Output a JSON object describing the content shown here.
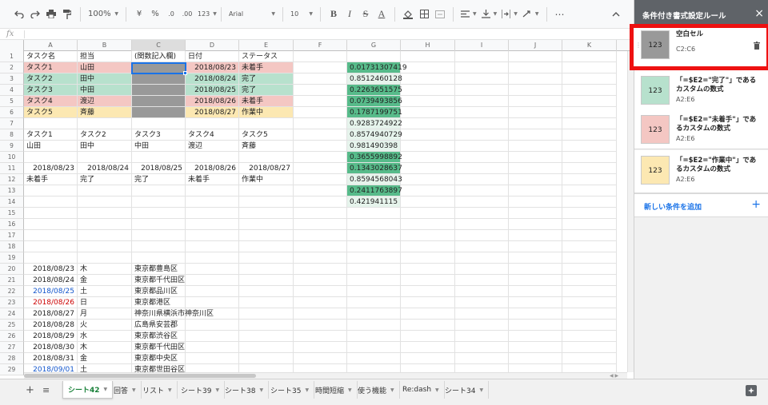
{
  "toolbar": {
    "undo_icon": "undo-icon",
    "redo_icon": "redo-icon",
    "print_icon": "print-icon",
    "paint_format_icon": "paint-format-icon",
    "zoom": "100%",
    "currency": "¥",
    "percent": "%",
    "decimal_decrease": ".0",
    "decimal_increase": ".00",
    "more_formats": "123",
    "font": "Arial",
    "font_size": "10",
    "bold": "B",
    "italic": "I",
    "strike": "S",
    "text_color": "A",
    "more": "⋯"
  },
  "formula_bar": {
    "label": "fx",
    "value": ""
  },
  "columns": [
    "A",
    "B",
    "C",
    "D",
    "E",
    "F",
    "G",
    "H",
    "I",
    "J",
    "K"
  ],
  "selected_column": "C",
  "rows": [
    {
      "n": "1",
      "cells": {
        "A": "タスク名",
        "B": "担当",
        "C": "(関数記入欄)",
        "D": "日付",
        "E": "ステータス"
      }
    },
    {
      "n": "2",
      "cells": {
        "A": "タスク1",
        "B": "山田",
        "C": "",
        "D": "2018/08/23",
        "E": "未着手",
        "G": "0.01731307419"
      }
    },
    {
      "n": "3",
      "cells": {
        "A": "タスク2",
        "B": "田中",
        "C": "",
        "D": "2018/08/24",
        "E": "完了",
        "G": "0.8512460128"
      }
    },
    {
      "n": "4",
      "cells": {
        "A": "タスク3",
        "B": "中田",
        "C": "",
        "D": "2018/08/25",
        "E": "完了",
        "G": "0.2263651575"
      }
    },
    {
      "n": "5",
      "cells": {
        "A": "タスク4",
        "B": "渡辺",
        "C": "",
        "D": "2018/08/26",
        "E": "未着手",
        "G": "0.0739493856"
      }
    },
    {
      "n": "6",
      "cells": {
        "A": "タスク5",
        "B": "斉藤",
        "C": "",
        "D": "2018/08/27",
        "E": "作業中",
        "G": "0.1787199751"
      }
    },
    {
      "n": "7",
      "cells": {
        "G": "0.9283724922"
      }
    },
    {
      "n": "8",
      "cells": {
        "A": "タスク1",
        "B": "タスク2",
        "C": "タスク3",
        "D": "タスク4",
        "E": "タスク5",
        "G": "0.8574940729"
      }
    },
    {
      "n": "9",
      "cells": {
        "A": "山田",
        "B": "田中",
        "C": "中田",
        "D": "渡辺",
        "E": "斉藤",
        "G": "0.981490398"
      }
    },
    {
      "n": "10",
      "cells": {
        "G": "0.3655998892"
      }
    },
    {
      "n": "11",
      "cells": {
        "A": "2018/08/23",
        "B": "2018/08/24",
        "C": "2018/08/25",
        "D": "2018/08/26",
        "E": "2018/08/27",
        "G": "0.1343028637"
      }
    },
    {
      "n": "12",
      "cells": {
        "A": "未着手",
        "B": "完了",
        "C": "完了",
        "D": "未着手",
        "E": "作業中",
        "G": "0.8594568043"
      }
    },
    {
      "n": "13",
      "cells": {
        "G": "0.2411763897"
      }
    },
    {
      "n": "14",
      "cells": {
        "G": "0.421941115"
      }
    },
    {
      "n": "15",
      "cells": {}
    },
    {
      "n": "16",
      "cells": {}
    },
    {
      "n": "17",
      "cells": {}
    },
    {
      "n": "18",
      "cells": {}
    },
    {
      "n": "19",
      "cells": {}
    },
    {
      "n": "20",
      "cells": {
        "A": "2018/08/23",
        "B": "木",
        "C": "東京都豊島区"
      }
    },
    {
      "n": "21",
      "cells": {
        "A": "2018/08/24",
        "B": "金",
        "C": "東京都千代田区"
      }
    },
    {
      "n": "22",
      "cells": {
        "A": "2018/08/25",
        "B": "土",
        "C": "東京都品川区"
      }
    },
    {
      "n": "23",
      "cells": {
        "A": "2018/08/26",
        "B": "日",
        "C": "東京都港区"
      }
    },
    {
      "n": "24",
      "cells": {
        "A": "2018/08/27",
        "B": "月",
        "C": "神奈川県横浜市神奈川区"
      }
    },
    {
      "n": "25",
      "cells": {
        "A": "2018/08/28",
        "B": "火",
        "C": "広島県安芸郡"
      }
    },
    {
      "n": "26",
      "cells": {
        "A": "2018/08/29",
        "B": "水",
        "C": "東京都渋谷区"
      }
    },
    {
      "n": "27",
      "cells": {
        "A": "2018/08/30",
        "B": "木",
        "C": "東京都千代田区"
      }
    },
    {
      "n": "28",
      "cells": {
        "A": "2018/08/31",
        "B": "金",
        "C": "東京都中央区"
      }
    },
    {
      "n": "29",
      "cells": {
        "A": "2018/09/01",
        "B": "土",
        "C": "東京都世田谷区"
      }
    }
  ],
  "sheet_tabs": [
    {
      "label": "シート42",
      "active": true
    },
    {
      "label": "回答",
      "active": false
    },
    {
      "label": "リスト",
      "active": false
    },
    {
      "label": "シート39",
      "active": false
    },
    {
      "label": "シート38",
      "active": false
    },
    {
      "label": "シート35",
      "active": false
    },
    {
      "label": "時間短縮",
      "active": false
    },
    {
      "label": "使う機能",
      "active": false
    },
    {
      "label": "Re:dash",
      "active": false
    },
    {
      "label": "シート34",
      "active": false
    }
  ],
  "panel": {
    "title": "条件付き書式設定ルール",
    "close": "×",
    "rules": [
      {
        "swatch_text": "123",
        "title": "空白セル",
        "range": "C2:C6",
        "color": "#999999",
        "highlighted": true
      },
      {
        "swatch_text": "123",
        "title": "「=$E2=\"完了\"」であるカスタムの数式",
        "range": "A2:E6",
        "color": "#b7e1cd",
        "highlighted": false
      },
      {
        "swatch_text": "123",
        "title": "「=$E2=\"未着手\"」であるカスタムの数式",
        "range": "A2:E6",
        "color": "#f4c7c3",
        "highlighted": false
      },
      {
        "swatch_text": "123",
        "title": "「=$E2=\"作業中\"」であるカスタムの数式",
        "range": "A2:E6",
        "color": "#fce8b2",
        "highlighted": false
      }
    ],
    "add_label": "新しい条件を追加",
    "add_plus": "+"
  },
  "colors": {
    "highlight_border": "#ee1111",
    "active_tab_text": "#188038",
    "accent": "#1a73e8"
  }
}
